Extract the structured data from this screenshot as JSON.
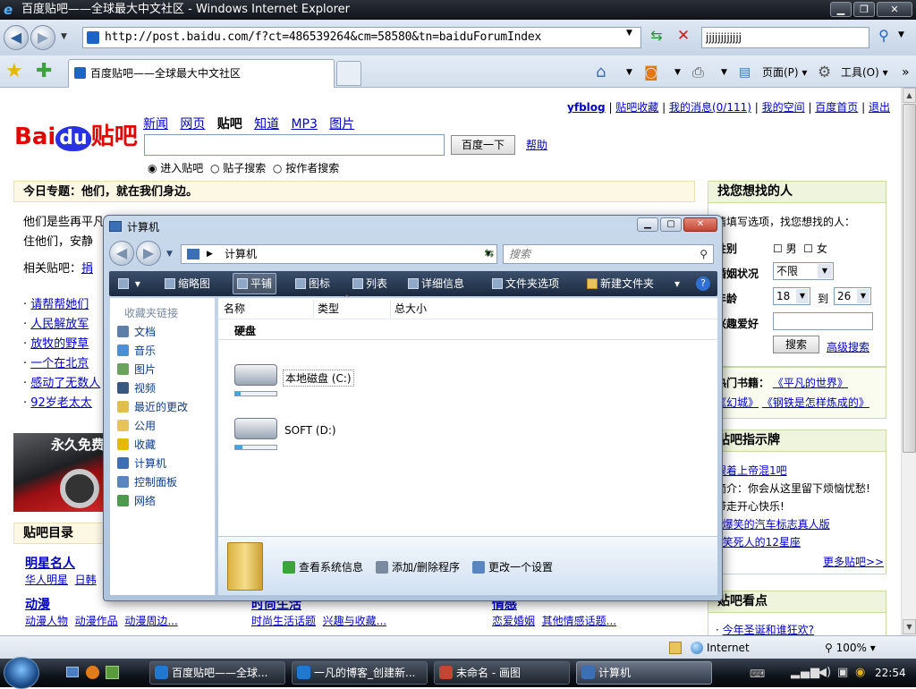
{
  "browser": {
    "title": "百度贴吧——全球最大中文社区 - Windows Internet Explorer",
    "url": "http://post.baidu.com/f?ct=486539264&cm=58580&tn=baiduForumIndex",
    "search_value": "jjjjjjjjjjjj",
    "tab_title": "百度贴吧——全球最大中文社区",
    "page_menu": "页面(P)",
    "tools_menu": "工具(O)",
    "status_zone": "Internet",
    "zoom": "100%"
  },
  "baidu": {
    "logo_text": "Bai",
    "logo_du": "du",
    "logo_suffix": "贴吧",
    "top_links": [
      "yfblog",
      "贴吧收藏",
      "我的消息(0/111)",
      "我的空间",
      "百度首页",
      "退出"
    ],
    "nav": [
      "新闻",
      "网页",
      "贴吧",
      "知道",
      "MP3",
      "图片"
    ],
    "search_button": "百度一下",
    "help": "帮助",
    "radios": [
      "进入贴吧",
      "贴子搜索",
      "按作者搜索"
    ],
    "topic_title": "今日专题：他们，就在我们身边。",
    "topic_line1": "他们是些再平凡",
    "topic_line2": "住他们，安静",
    "related": "相关贴吧：",
    "related_link": "捐",
    "topic_links": [
      "请帮帮她们",
      "人民解放军",
      "放牧的野草",
      "一个在北京",
      "感动了无数人",
      "92岁老太太"
    ],
    "ad_text": "永久免费",
    "dir_title": "贴吧目录",
    "dir_cat1": "明星名人",
    "dir_cat1_subs": [
      "华人明星",
      "日韩"
    ],
    "dir_row2": [
      {
        "title": "动漫",
        "subs": [
          "动漫人物",
          "动漫作品",
          "动漫周边..."
        ]
      },
      {
        "title": "时尚生活",
        "subs": [
          "时尚生活话题",
          "兴趣与收藏..."
        ]
      },
      {
        "title": "情感",
        "subs": [
          "恋爱婚姻",
          "其他情感话题..."
        ]
      }
    ],
    "right": {
      "find_title": "找您想找的人",
      "find_hint": "请填写选项，找您想找的人：",
      "gender_label": "性别",
      "male": "男",
      "female": "女",
      "marital_label": "婚姻状况",
      "marital_value": "不限",
      "age_label": "年龄",
      "age_from": "18",
      "age_to_word": "到",
      "age_to": "26",
      "hobby_label": "兴趣爱好",
      "search_btn": "搜索",
      "adv_search": "高级搜索",
      "books_label": "热门书籍：",
      "books": [
        "《平凡的世界》",
        "《幻城》",
        "《钢铁是怎样炼成的》"
      ],
      "guide_title": "贴吧指示牌",
      "guide_link1": "跟着上帝混1吧",
      "guide_intro": "简介：你会从这里留下烦恼忧愁!",
      "guide_intro2": "带走开心快乐!",
      "guide_links": [
        "爆笑的汽车标志真人版",
        "笑死人的12星座"
      ],
      "more": "更多贴吧>>",
      "look_title": "贴吧看点",
      "look_item": "今年圣诞和谁狂欢?"
    }
  },
  "explorer": {
    "title": "计算机",
    "address": "计算机",
    "search_placeholder": "搜索",
    "toolbar": [
      "缩略图",
      "平铺",
      "图标",
      "列表",
      "详细信息",
      "文件夹选项",
      "新建文件夹"
    ],
    "fav_header": "收藏夹链接",
    "favorites": [
      "文档",
      "音乐",
      "图片",
      "视频",
      "最近的更改",
      "公用",
      "收藏",
      "计算机",
      "控制面板",
      "网络"
    ],
    "columns": [
      "名称",
      "类型",
      "总大小"
    ],
    "group": "硬盘",
    "drives": [
      {
        "label": "本地磁盘 (C:)",
        "used_fraction": 0.1
      },
      {
        "label": "SOFT (D:)",
        "used_fraction": 0.15
      }
    ],
    "actions": [
      "查看系统信息",
      "添加/删除程序",
      "更改一个设置"
    ]
  },
  "taskbar": {
    "tasks": [
      "百度贴吧——全球...",
      "一凡的博客_创建新...",
      "未命名 - 画图",
      "计算机"
    ],
    "clock": "22:54"
  },
  "colors": {
    "ie_blue": "#1c64c8",
    "baidu_red": "#e10602",
    "baidu_blue": "#2932e1",
    "link": "#0000cc"
  }
}
